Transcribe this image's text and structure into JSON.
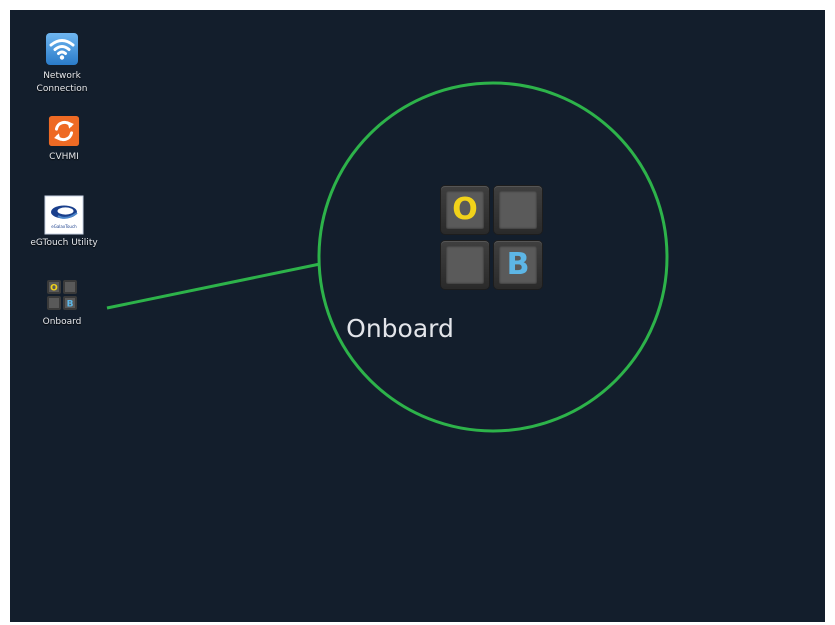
{
  "desktop": {
    "icons": [
      {
        "label_lines": [
          "Network",
          "Connection"
        ],
        "icon": "wifi-icon",
        "color": "#3a8fd8"
      },
      {
        "label_lines": [
          "CVHMI"
        ],
        "icon": "refresh-icon",
        "color": "#ee6a24"
      },
      {
        "label_lines": [
          "eGTouch Utility"
        ],
        "icon": "egtouch-logo-icon",
        "color": "#1a3f8c",
        "logo_text": "eGalaxTouch"
      },
      {
        "label_lines": [
          "Onboard"
        ],
        "icon": "onboard-keyboard-icon"
      }
    ]
  },
  "callout": {
    "label": "Onboard",
    "keys": [
      "O",
      "",
      "",
      "B"
    ],
    "circle_color": "#2db34a",
    "key_o_color": "#f1d21a",
    "key_b_color": "#5db6e6"
  },
  "colors": {
    "desktop_background": "#131e2c"
  }
}
